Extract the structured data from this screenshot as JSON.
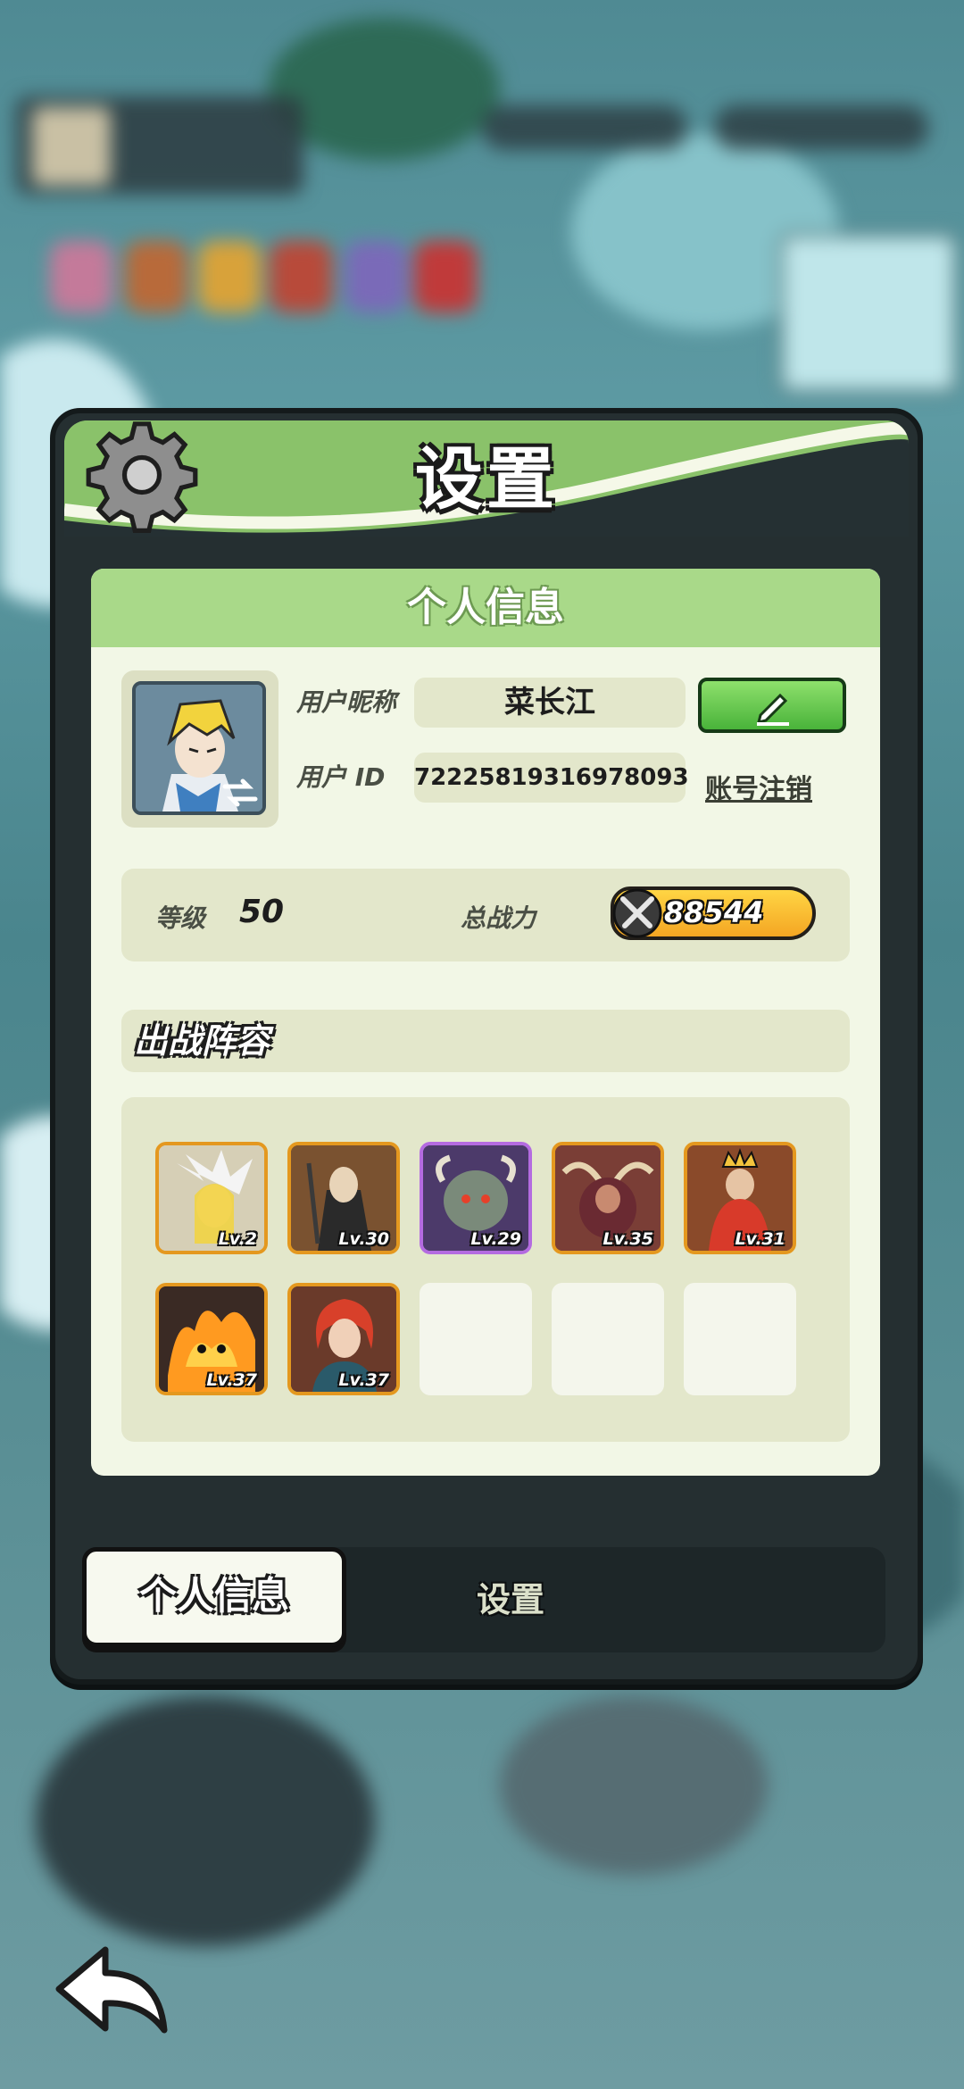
{
  "dialog": {
    "title": "设置",
    "panel_title": "个人信息"
  },
  "profile": {
    "nickname_label": "用户昵称",
    "nickname": "菜长江",
    "id_label": "用户 ID",
    "user_id": "72225819316978093",
    "account_cancel": "账号注销"
  },
  "stats": {
    "level_label": "等级",
    "level_value": "50",
    "power_label": "总战力",
    "power_value": "88544"
  },
  "lineup": {
    "title": "出战阵容",
    "heroes": [
      {
        "level": "Lv.2",
        "color": "#e6dcc0",
        "accent": "#f2d33d"
      },
      {
        "level": "Lv.30",
        "color": "#6b4a2c",
        "accent": "#2a2a2a"
      },
      {
        "level": "Lv.29",
        "color": "#4c3a6a",
        "accent": "#7a8a7a"
      },
      {
        "level": "Lv.35",
        "color": "#8a4a3a",
        "accent": "#6a2a32"
      },
      {
        "level": "Lv.31",
        "color": "#b04a2a",
        "accent": "#d8b24a"
      },
      {
        "level": "Lv.37",
        "color": "#a8451c",
        "accent": "#ffb020"
      },
      {
        "level": "Lv.37",
        "color": "#2a4a5a",
        "accent": "#d8402a"
      }
    ],
    "empty_slots": 3
  },
  "tabs": {
    "active": "个人信息",
    "inactive": "设置"
  },
  "icons": {
    "gear": "gear-icon",
    "edit": "pencil-icon",
    "swap": "swap-arrows-icon",
    "power": "crossed-swords-icon",
    "back": "back-arrow-icon"
  },
  "colors": {
    "header_green": "#8ac26a",
    "panel_head_green": "#a9d989",
    "edit_button": "#49b33a",
    "power_badge": "#f4a623"
  }
}
